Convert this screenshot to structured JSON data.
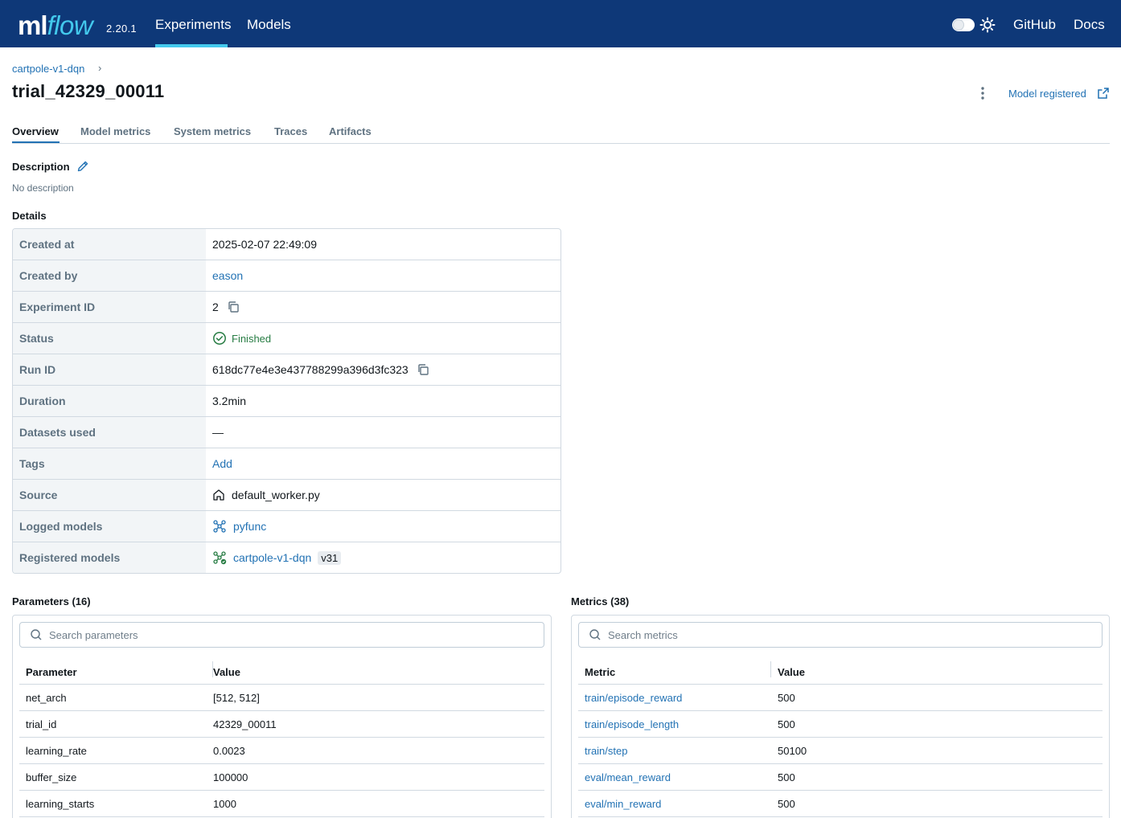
{
  "header": {
    "logo_ml": "ml",
    "logo_flow": "flow",
    "version": "2.20.1",
    "nav": [
      "Experiments",
      "Models"
    ],
    "github": "GitHub",
    "docs": "Docs",
    "colors": {
      "bar": "#0e3878",
      "accent": "#43c9ed"
    }
  },
  "breadcrumb": {
    "experiment": "cartpole-v1-dqn",
    "separator": "›"
  },
  "run": {
    "title": "trial_42329_00011",
    "model_registered": "Model registered"
  },
  "tabs": [
    "Overview",
    "Model metrics",
    "System metrics",
    "Traces",
    "Artifacts"
  ],
  "description": {
    "label": "Description",
    "value": "No description"
  },
  "details": {
    "label": "Details",
    "rows": [
      {
        "key": "Created at",
        "value": "2025-02-07 22:49:09"
      },
      {
        "key": "Created by",
        "value": "eason"
      },
      {
        "key": "Experiment ID",
        "value": "2"
      },
      {
        "key": "Status",
        "value": "Finished"
      },
      {
        "key": "Run ID",
        "value": "618dc77e4e3e437788299a396d3fc323"
      },
      {
        "key": "Duration",
        "value": "3.2min"
      },
      {
        "key": "Datasets used",
        "value": "—"
      },
      {
        "key": "Tags",
        "value": "Add"
      },
      {
        "key": "Source",
        "value": "default_worker.py"
      },
      {
        "key": "Logged models",
        "value": "pyfunc"
      },
      {
        "key": "Registered models",
        "value": "cartpole-v1-dqn",
        "badge": "v31"
      }
    ]
  },
  "parameters": {
    "title": "Parameters (16)",
    "search_placeholder": "Search parameters",
    "columns": [
      "Parameter",
      "Value"
    ],
    "rows": [
      [
        "net_arch",
        "[512, 512]"
      ],
      [
        "trial_id",
        "42329_00011"
      ],
      [
        "learning_rate",
        "0.0023"
      ],
      [
        "buffer_size",
        "100000"
      ],
      [
        "learning_starts",
        "1000"
      ]
    ]
  },
  "metrics": {
    "title": "Metrics (38)",
    "search_placeholder": "Search metrics",
    "columns": [
      "Metric",
      "Value"
    ],
    "rows": [
      [
        "train/episode_reward",
        "500"
      ],
      [
        "train/episode_length",
        "500"
      ],
      [
        "train/step",
        "50100"
      ],
      [
        "eval/mean_reward",
        "500"
      ],
      [
        "eval/min_reward",
        "500"
      ]
    ]
  }
}
